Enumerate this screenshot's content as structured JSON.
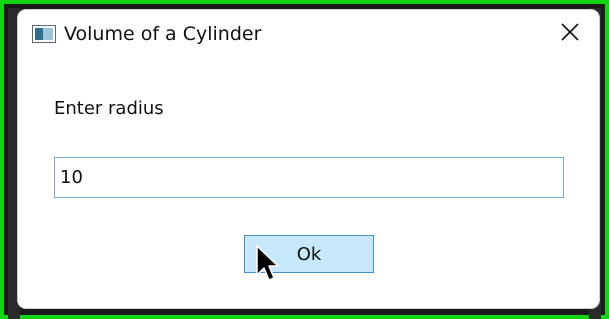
{
  "window": {
    "title": "Volume of a Cylinder",
    "icon": "app-window-icon",
    "close_icon": "close-icon"
  },
  "form": {
    "prompt": "Enter radius",
    "radius_value": "10"
  },
  "buttons": {
    "ok_label": "Ok"
  },
  "colors": {
    "outer_border": "#12d612",
    "ok_background": "#c7e7fa",
    "ok_border": "#4a8fd0",
    "input_border": "#7aa7d0"
  }
}
